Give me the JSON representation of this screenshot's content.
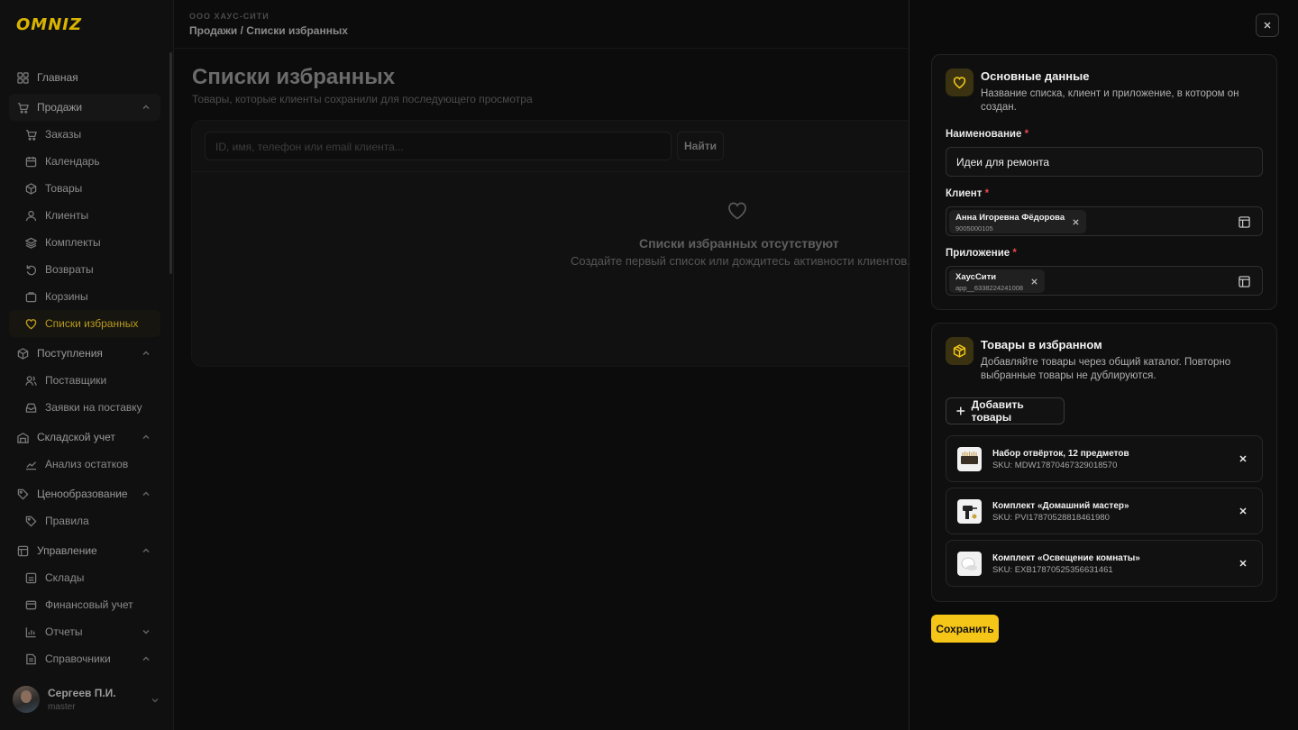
{
  "brand": {
    "logo_text": "OMNIZ",
    "accent": "#f5c518"
  },
  "sidebar": {
    "items": [
      {
        "label": "Главная",
        "icon": "dashboard-icon",
        "type": "group"
      },
      {
        "label": "Продажи",
        "icon": "cart-icon",
        "type": "group",
        "expanded": true
      },
      {
        "label": "Заказы",
        "icon": "cart-icon",
        "type": "sub"
      },
      {
        "label": "Календарь",
        "icon": "calendar-icon",
        "type": "sub"
      },
      {
        "label": "Товары",
        "icon": "box-icon",
        "type": "sub"
      },
      {
        "label": "Клиенты",
        "icon": "user-icon",
        "type": "sub"
      },
      {
        "label": "Комплекты",
        "icon": "layers-icon",
        "type": "sub"
      },
      {
        "label": "Возвраты",
        "icon": "return-icon",
        "type": "sub"
      },
      {
        "label": "Корзины",
        "icon": "basket-icon",
        "type": "sub"
      },
      {
        "label": "Списки избранных",
        "icon": "heart-icon",
        "type": "sub",
        "active": true
      },
      {
        "label": "Поступления",
        "icon": "box-icon",
        "type": "group",
        "expanded": true
      },
      {
        "label": "Поставщики",
        "icon": "users-icon",
        "type": "sub"
      },
      {
        "label": "Заявки на поставку",
        "icon": "inbox-icon",
        "type": "sub"
      },
      {
        "label": "Складской учет",
        "icon": "warehouse-icon",
        "type": "group",
        "expanded": true
      },
      {
        "label": "Анализ остатков",
        "icon": "trend-icon",
        "type": "sub"
      },
      {
        "label": "Ценообразование",
        "icon": "tag-icon",
        "type": "group",
        "expanded": true
      },
      {
        "label": "Правила",
        "icon": "tag-icon",
        "type": "sub"
      },
      {
        "label": "Управление",
        "icon": "layout-icon",
        "type": "group",
        "expanded": true
      },
      {
        "label": "Склады",
        "icon": "warehouse-icon",
        "type": "sub"
      },
      {
        "label": "Финансовый учет",
        "icon": "wallet-icon",
        "type": "sub"
      },
      {
        "label": "Отчеты",
        "icon": "chart-icon",
        "type": "sub",
        "has_children": true
      },
      {
        "label": "Справочники",
        "icon": "book-icon",
        "type": "sub",
        "has_children": true
      }
    ],
    "user": {
      "name": "Сергеев П.И.",
      "role": "master"
    }
  },
  "header": {
    "org": "ООО ХАУС-СИТИ",
    "breadcrumb": "Продажи / Списки избранных"
  },
  "main": {
    "title": "Списки избранных",
    "subtitle": "Товары, которые клиенты сохранили для последующего просмотра",
    "search_placeholder": "ID, имя, телефон или email клиента...",
    "search_button": "Найти",
    "empty_title": "Списки избранных отсутствуют",
    "empty_text": "Создайте первый список или дождитесь активности клиентов."
  },
  "drawer": {
    "basic": {
      "title": "Основные данные",
      "description": "Название списка, клиент и приложение, в котором он создан.",
      "name_label": "Наименование",
      "name_value": "Идеи для ремонта",
      "client_label": "Клиент",
      "client_name": "Анна Игоревна Фёдорова",
      "client_phone": "9005000105",
      "app_label": "Приложение",
      "app_name": "ХаусСити",
      "app_id": "app__6338224241008",
      "required_mark": "*"
    },
    "products": {
      "title": "Товары в избранном",
      "description": "Добавляйте товары через общий каталог. Повторно выбранные товары не дублируются.",
      "add_button": "Добавить товары",
      "items": [
        {
          "name": "Набор отвёрток, 12 предметов",
          "sku": "SKU: MDW17870467329018570"
        },
        {
          "name": "Комплект «Домашний мастер»",
          "sku": "SKU: PVI17870528818461980"
        },
        {
          "name": "Комплект «Освещение комнаты»",
          "sku": "SKU: EXB17870525356631461"
        }
      ]
    },
    "save_button": "Сохранить"
  }
}
